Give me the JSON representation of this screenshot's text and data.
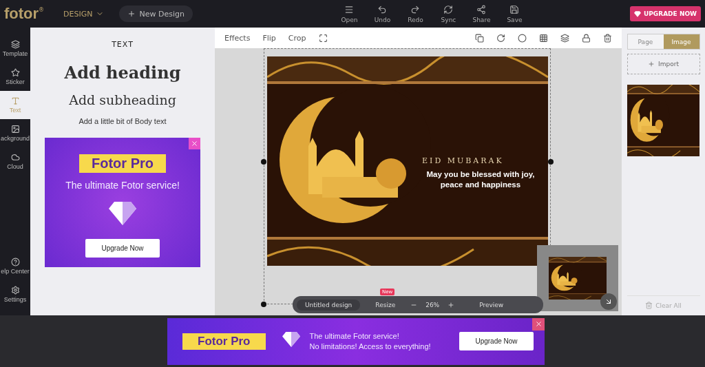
{
  "app": {
    "logo": "fotor",
    "logo_mark": "®",
    "mode": "DESIGN",
    "new_design": "New Design"
  },
  "toolbar": [
    {
      "label": "Open"
    },
    {
      "label": "Undo"
    },
    {
      "label": "Redo"
    },
    {
      "label": "Sync"
    },
    {
      "label": "Share"
    },
    {
      "label": "Save"
    }
  ],
  "upgrade": "UPGRADE NOW",
  "nav": [
    {
      "label": "Template",
      "selected": false
    },
    {
      "label": "Sticker",
      "selected": false
    },
    {
      "label": "Text",
      "selected": true
    },
    {
      "label": "ackground",
      "selected": false
    },
    {
      "label": "Cloud",
      "selected": false
    },
    {
      "label": "elp Center",
      "selected": false
    },
    {
      "label": "Settings",
      "selected": false
    }
  ],
  "text_panel": {
    "title": "TEXT",
    "heading": "Add heading",
    "subheading": "Add subheading",
    "body": "Add a little bit of Body text"
  },
  "side_ad": {
    "title": "Fotor Pro",
    "tagline": "The ultimate Fotor service!",
    "button": "Upgrade Now"
  },
  "edit_tools": [
    "Effects",
    "Flip",
    "Crop"
  ],
  "design": {
    "greeting": "EID MUBARAK",
    "message": "May you be blessed with joy, peace and happiness"
  },
  "bottom_bar": {
    "name": "Untitled design",
    "resize": "Resize",
    "badge": "New",
    "zoom": "26%",
    "preview": "Preview"
  },
  "right_panel": {
    "tabs": [
      {
        "label": "Page",
        "selected": false
      },
      {
        "label": "Image",
        "selected": true
      }
    ],
    "import": "Import",
    "clear": "Clear All"
  },
  "bottom_ad": {
    "title": "Fotor Pro",
    "line1": "The ultimate Fotor service!",
    "line2": "No limitations! Access to everything!",
    "button": "Upgrade Now"
  }
}
